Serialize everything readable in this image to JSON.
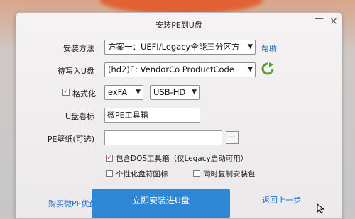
{
  "window": {
    "title": "安装PE到U盘",
    "minimize_glyph": "—",
    "close_glyph": "×"
  },
  "install_method": {
    "label": "安装方法",
    "value": "方案一：UEFI/Legacy全能三分区方",
    "help": "帮助"
  },
  "target_disk": {
    "label": "待写入U盘",
    "value": "(hd2)E: VendorCo ProductCode",
    "refresh_icon": "refresh-icon"
  },
  "format": {
    "checked": true,
    "label": "格式化",
    "fs_value": "exFA",
    "mode_value": "USB-HD"
  },
  "volume": {
    "label": "U盘卷标",
    "value": "微PE工具箱"
  },
  "wallpaper": {
    "label": "PE壁纸(可选)",
    "value": "",
    "browse": "..."
  },
  "options": [
    {
      "checked": true,
      "label": "包含DOS工具箱（仅Legacy启动可用）"
    },
    {
      "checked": false,
      "label": "个性化盘符图标"
    },
    {
      "checked": false,
      "label": "同时复制安装包"
    }
  ],
  "footer": {
    "buy_link": "购买微PE优盘",
    "install_button": "立即安装进U盘",
    "back_link": "返回上一步"
  },
  "colors": {
    "accent": "#2d87d4",
    "link": "#1c6dc9",
    "check": "#c0392b"
  }
}
